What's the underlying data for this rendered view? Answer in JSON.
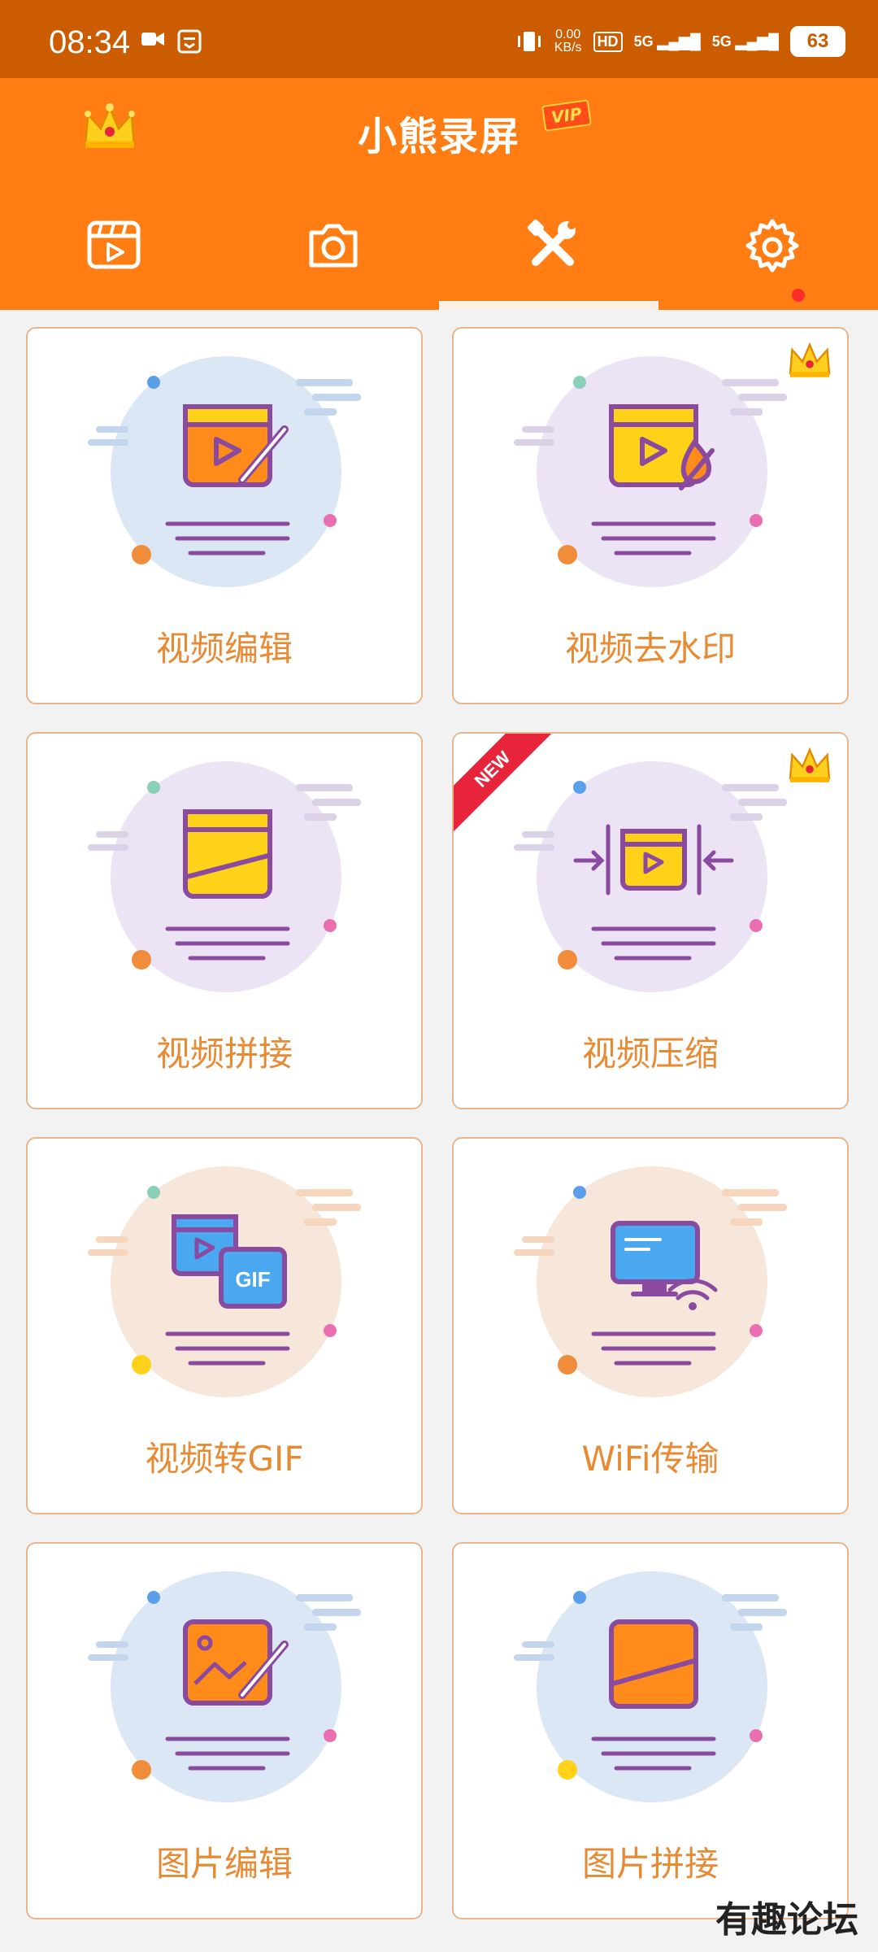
{
  "status": {
    "time": "08:34",
    "net_speed_value": "0.00",
    "net_speed_unit": "KB/s",
    "hd": "HD",
    "signal1": "5G",
    "signal2": "5G",
    "battery": "63"
  },
  "header": {
    "title": "小熊录屏",
    "vip": "VIP"
  },
  "tabs": [
    {
      "name": "video-list",
      "icon": "video-clapper-icon"
    },
    {
      "name": "camera",
      "icon": "camera-icon"
    },
    {
      "name": "tools",
      "icon": "tools-icon",
      "selected": true
    },
    {
      "name": "settings",
      "icon": "gear-icon",
      "has_badge": true
    }
  ],
  "tools": [
    {
      "label": "视频编辑",
      "premium": false,
      "is_new": false
    },
    {
      "label": "视频去水印",
      "premium": true,
      "is_new": false
    },
    {
      "label": "视频拼接",
      "premium": false,
      "is_new": false
    },
    {
      "label": "视频压缩",
      "premium": true,
      "is_new": true,
      "new_text": "NEW"
    },
    {
      "label": "视频转GIF",
      "premium": false,
      "is_new": false,
      "gif_text": "GIF"
    },
    {
      "label": "WiFi传输",
      "premium": false,
      "is_new": false
    },
    {
      "label": "图片编辑",
      "premium": false,
      "is_new": false
    },
    {
      "label": "图片拼接",
      "premium": false,
      "is_new": false
    }
  ],
  "watermark": "有趣论坛",
  "colors": {
    "status_bar": "#cc5c00",
    "header": "#ff7d12",
    "label": "#e78a34",
    "card_border": "#e8b58c"
  }
}
